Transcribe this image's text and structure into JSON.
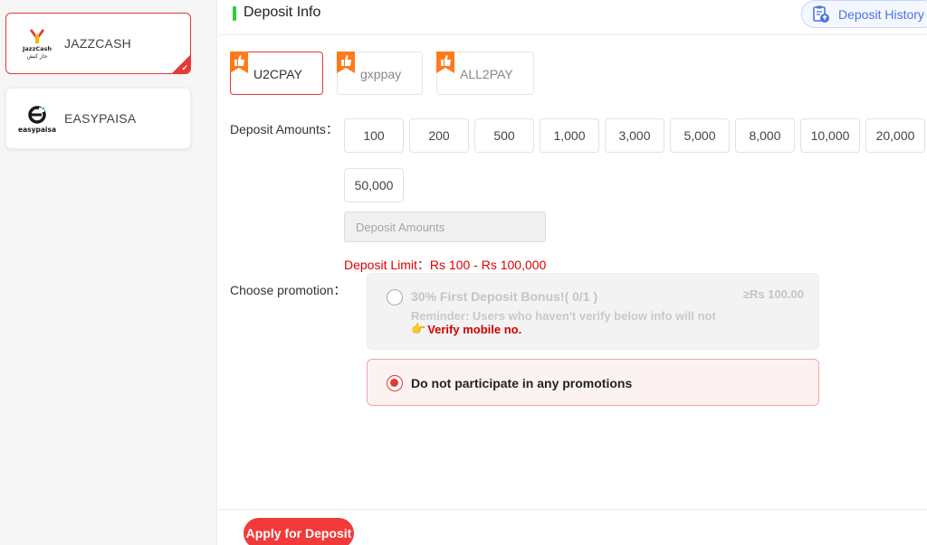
{
  "sidebar": {
    "methods": [
      {
        "label": "JAZZCASH",
        "logo_text_top": "JazzCash",
        "logo_text_bottom": "جاز کیش"
      },
      {
        "label": "EASYPAISA",
        "logo_text": "easypaisa"
      }
    ]
  },
  "header": {
    "title": "Deposit Info",
    "history_label": "Deposit History"
  },
  "channels": [
    {
      "label": "U2CPAY"
    },
    {
      "label": "gxppay"
    },
    {
      "label": "ALL2PAY"
    }
  ],
  "amounts": {
    "label": "Deposit Amounts：",
    "options": [
      "100",
      "200",
      "500",
      "1,000",
      "3,000",
      "5,000",
      "8,000",
      "10,000",
      "20,000",
      "50,000"
    ],
    "input_placeholder": "Deposit Amounts",
    "limit_text": "Deposit Limit：Rs  100  - Rs  100,000"
  },
  "promotion": {
    "label": "Choose promotion：",
    "bonus_title": "30% First Deposit Bonus!( 0/1 )",
    "bonus_min": "≥Rs  100.00",
    "reminder": "Reminder: Users who haven't verify below info will not be able to participate",
    "verify_label": "Verify mobile no.",
    "no_promo_label": "Do not participate in any promotions"
  },
  "footer": {
    "apply_label": "Apply for Deposit"
  },
  "colors": {
    "accent": "#e53935",
    "header_bar": "#2ecc40",
    "history": "#4a74e0",
    "limit": "#e00000"
  }
}
